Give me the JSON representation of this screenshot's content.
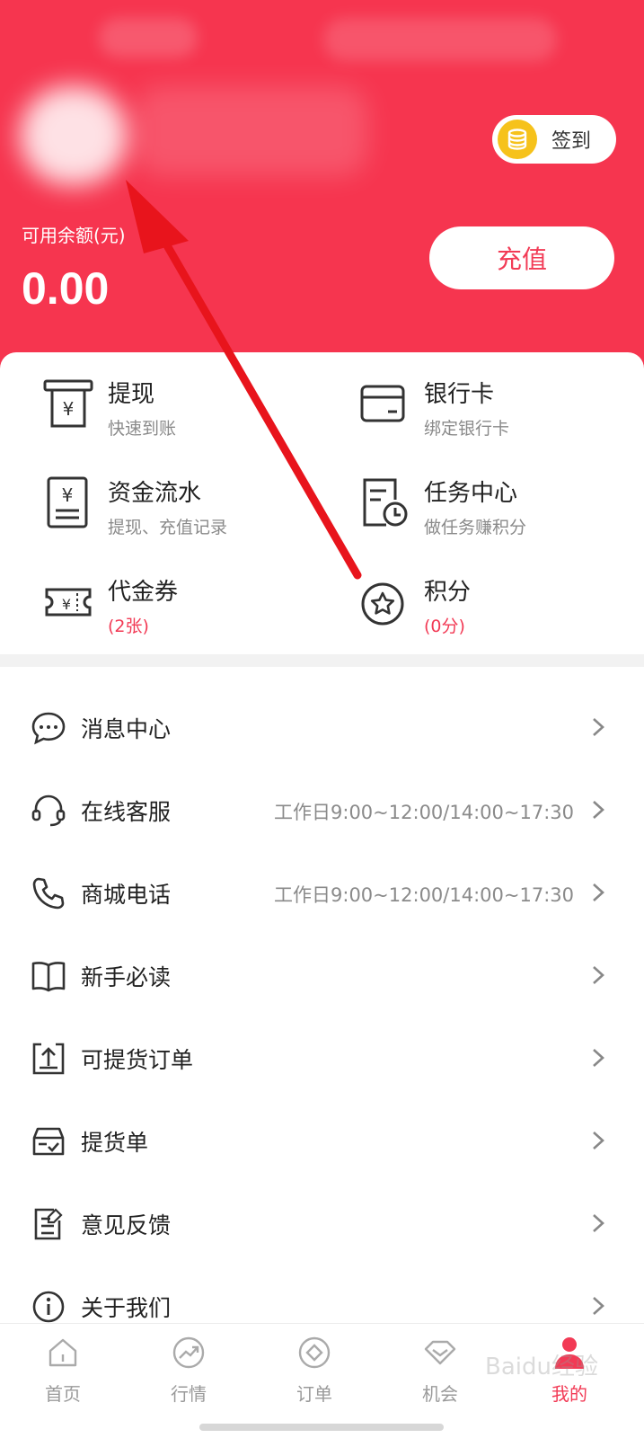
{
  "header": {
    "signin_label": "签到",
    "balance_label": "可用余额(元)",
    "balance_value": "0.00",
    "recharge_label": "充值"
  },
  "grid": [
    {
      "title": "提现",
      "subtitle": "快速到账",
      "icon": "atm-withdraw-icon",
      "sub_color": "#8a8a8a"
    },
    {
      "title": "银行卡",
      "subtitle": "绑定银行卡",
      "icon": "bank-card-icon",
      "sub_color": "#8a8a8a"
    },
    {
      "title": "资金流水",
      "subtitle": "提现、充值记录",
      "icon": "fund-record-icon",
      "sub_color": "#8a8a8a"
    },
    {
      "title": "任务中心",
      "subtitle": "做任务赚积分",
      "icon": "task-clock-icon",
      "sub_color": "#8a8a8a"
    },
    {
      "title": "代金券",
      "subtitle": "(2张)",
      "icon": "voucher-ticket-icon",
      "sub_color": "#f23a55"
    },
    {
      "title": "积分",
      "subtitle": "(0分)",
      "icon": "star-points-icon",
      "sub_color": "#f23a55"
    }
  ],
  "menu": [
    {
      "label": "消息中心",
      "note": "",
      "icon": "message-bubble-icon"
    },
    {
      "label": "在线客服",
      "note": "工作日9:00~12:00/14:00~17:30",
      "icon": "headset-icon"
    },
    {
      "label": "商城电话",
      "note": "工作日9:00~12:00/14:00~17:30",
      "icon": "phone-icon"
    },
    {
      "label": "新手必读",
      "note": "",
      "icon": "book-icon"
    },
    {
      "label": "可提货订单",
      "note": "",
      "icon": "upload-box-icon"
    },
    {
      "label": "提货单",
      "note": "",
      "icon": "delivery-box-icon"
    },
    {
      "label": "意见反馈",
      "note": "",
      "icon": "feedback-edit-icon"
    },
    {
      "label": "关于我们",
      "note": "",
      "icon": "info-circle-icon"
    }
  ],
  "tabs": [
    {
      "label": "首页",
      "icon": "home-icon",
      "active": false
    },
    {
      "label": "行情",
      "icon": "trend-chart-icon",
      "active": false
    },
    {
      "label": "订单",
      "icon": "order-diamond-icon",
      "active": false
    },
    {
      "label": "机会",
      "icon": "gem-icon",
      "active": false
    },
    {
      "label": "我的",
      "icon": "user-profile-icon",
      "active": true
    }
  ],
  "colors": {
    "brand_red": "#f6354f",
    "accent_red": "#f23a55",
    "coin_yellow": "#f6c21b",
    "annotation_arrow": "#e8141c"
  },
  "watermark": "Baidu经验"
}
